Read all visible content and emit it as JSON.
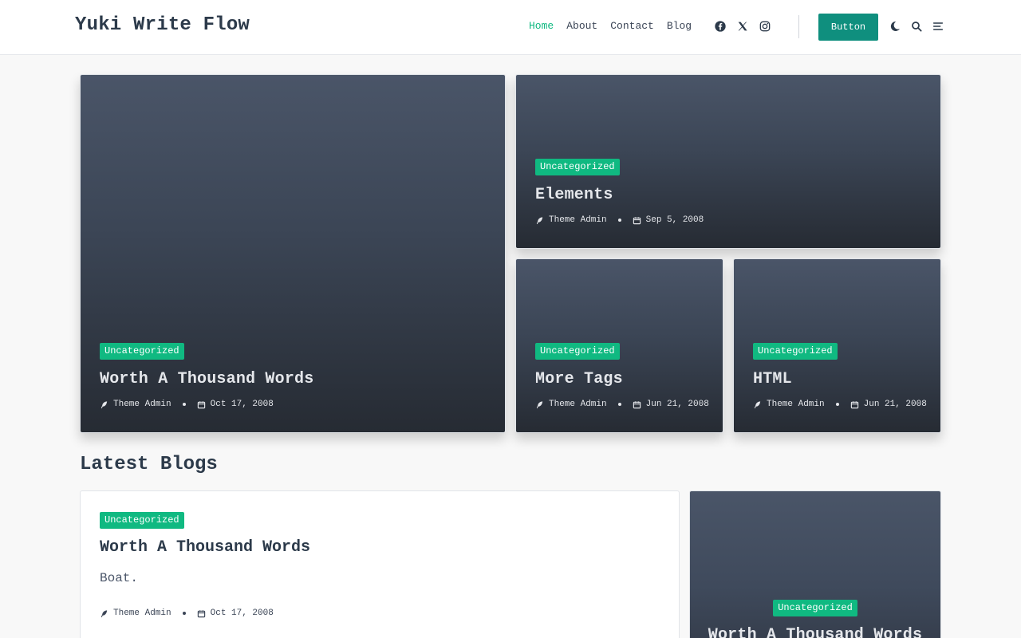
{
  "site": {
    "title": "Yuki Write Flow"
  },
  "nav": {
    "items": [
      "Home",
      "About",
      "Contact",
      "Blog"
    ]
  },
  "header": {
    "button_label": "Button"
  },
  "hero": [
    {
      "category": "Uncategorized",
      "title": "Worth A Thousand Words",
      "author": "Theme Admin",
      "date": "Oct 17, 2008"
    },
    {
      "category": "Uncategorized",
      "title": "Elements",
      "author": "Theme Admin",
      "date": "Sep 5, 2008"
    },
    {
      "category": "Uncategorized",
      "title": "More Tags",
      "author": "Theme Admin",
      "date": "Jun 21, 2008"
    },
    {
      "category": "Uncategorized",
      "title": "HTML",
      "author": "Theme Admin",
      "date": "Jun 21, 2008"
    }
  ],
  "latest": {
    "heading": "Latest Blogs",
    "post": {
      "category": "Uncategorized",
      "title": "Worth A Thousand Words",
      "excerpt": "Boat.",
      "author": "Theme Admin",
      "date": "Oct 17, 2008"
    },
    "side": {
      "category": "Uncategorized",
      "title": "Worth A Thousand Words"
    }
  },
  "colors": {
    "accent": "#10b981",
    "button": "#0f8f7e",
    "text": "#2c3a4a"
  },
  "icons": [
    "facebook-icon",
    "x-twitter-icon",
    "instagram-icon",
    "moon-icon",
    "search-icon",
    "menu-icon",
    "feather-icon",
    "calendar-icon"
  ]
}
